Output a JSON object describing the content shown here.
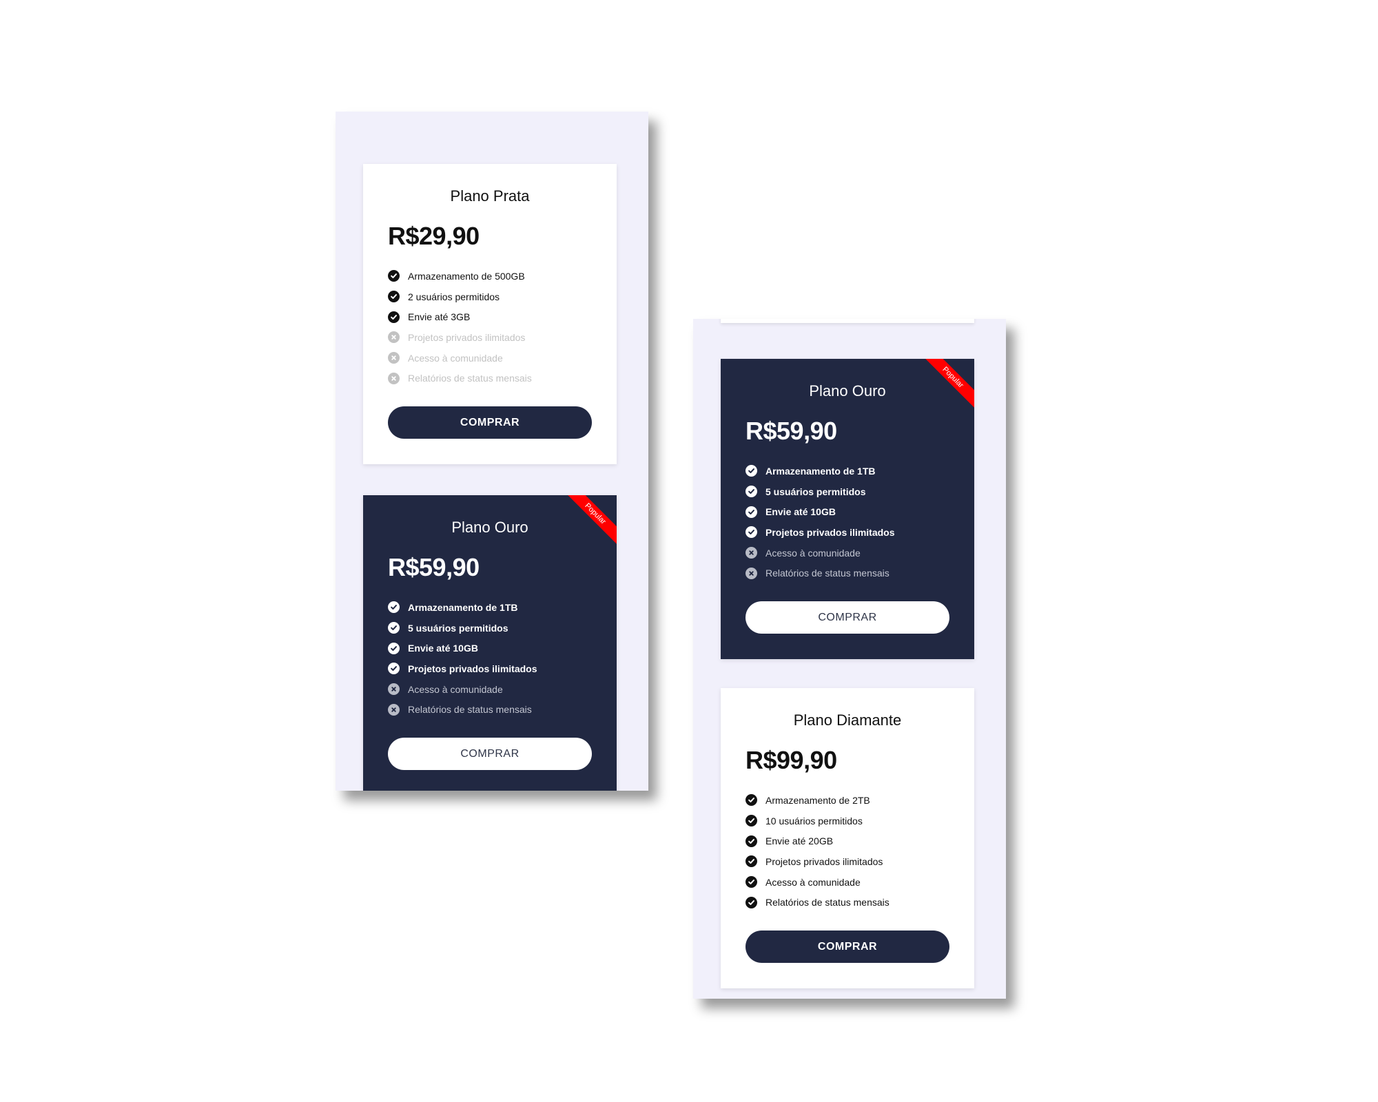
{
  "left_screen": {
    "cards": [
      {
        "title": "Plano Prata",
        "price": "R$29,90",
        "features": [
          {
            "label": "Armazenamento de 500GB",
            "included": true
          },
          {
            "label": "2 usuários permitidos",
            "included": true
          },
          {
            "label": "Envie até 3GB",
            "included": true
          },
          {
            "label": "Projetos privados ilimitados",
            "included": false
          },
          {
            "label": "Acesso à comunidade",
            "included": false
          },
          {
            "label": "Relatórios de status mensais",
            "included": false
          }
        ],
        "button": "COMPRAR"
      },
      {
        "title": "Plano Ouro",
        "price": "R$59,90",
        "ribbon": "Popular",
        "features": [
          {
            "label": "Armazenamento de 1TB",
            "included": true
          },
          {
            "label": "5 usuários permitidos",
            "included": true
          },
          {
            "label": "Envie até 10GB",
            "included": true
          },
          {
            "label": "Projetos privados ilimitados",
            "included": true
          },
          {
            "label": "Acesso à comunidade",
            "included": false
          },
          {
            "label": "Relatórios de status mensais",
            "included": false
          }
        ],
        "button": "COMPRAR"
      }
    ]
  },
  "right_screen": {
    "cards": [
      {
        "title": "Plano Ouro",
        "price": "R$59,90",
        "ribbon": "Popular",
        "features": [
          {
            "label": "Armazenamento de 1TB",
            "included": true
          },
          {
            "label": "5 usuários permitidos",
            "included": true
          },
          {
            "label": "Envie até 10GB",
            "included": true
          },
          {
            "label": "Projetos privados ilimitados",
            "included": true
          },
          {
            "label": "Acesso à comunidade",
            "included": false
          },
          {
            "label": "Relatórios de status mensais",
            "included": false
          }
        ],
        "button": "COMPRAR"
      },
      {
        "title": "Plano Diamante",
        "price": "R$99,90",
        "features": [
          {
            "label": "Armazenamento de 2TB",
            "included": true
          },
          {
            "label": "10 usuários permitidos",
            "included": true
          },
          {
            "label": "Envie até 20GB",
            "included": true
          },
          {
            "label": "Projetos privados ilimitados",
            "included": true
          },
          {
            "label": "Acesso à comunidade",
            "included": true
          },
          {
            "label": "Relatórios de status mensais",
            "included": true
          }
        ],
        "button": "COMPRAR"
      }
    ]
  },
  "colors": {
    "screen_bg": "#f1f0fb",
    "dark_card": "#212842",
    "light_card": "#ffffff",
    "ribbon": "#ff0000"
  },
  "icons": {
    "included": "check-circle-icon",
    "excluded": "x-circle-icon"
  }
}
